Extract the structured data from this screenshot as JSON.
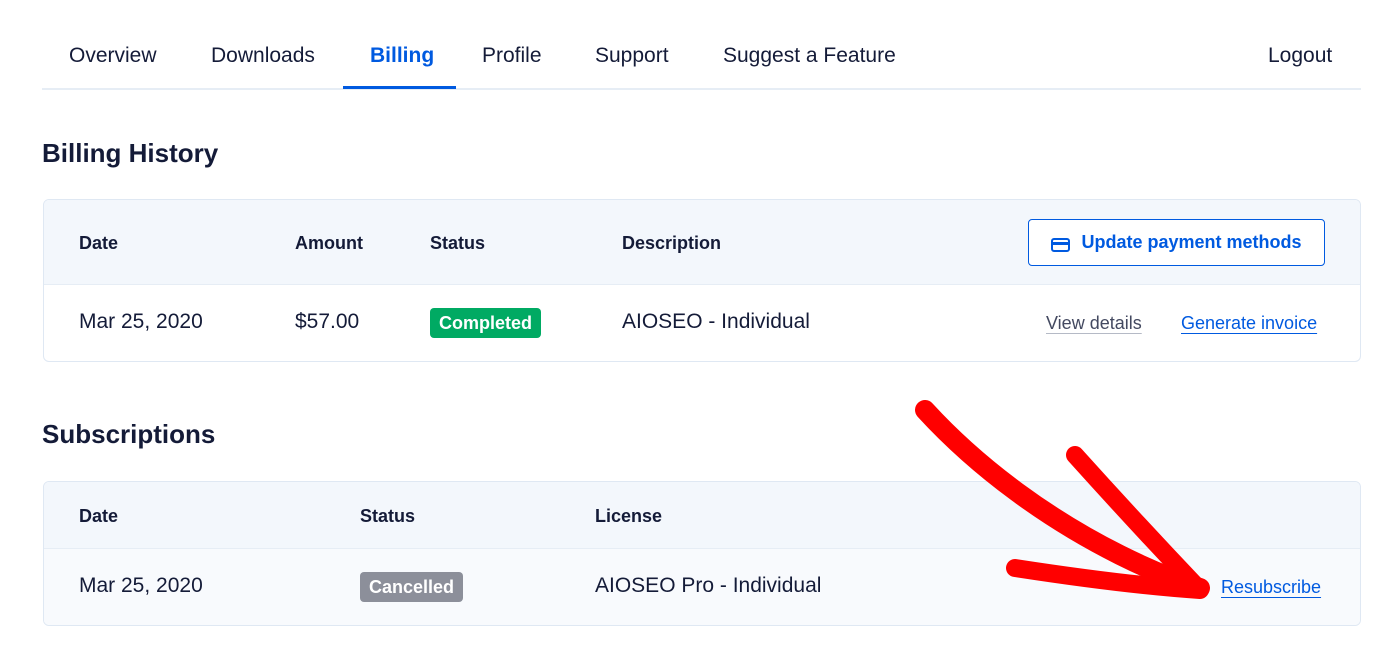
{
  "nav": {
    "items": [
      {
        "label": "Overview",
        "active": false
      },
      {
        "label": "Downloads",
        "active": false
      },
      {
        "label": "Billing",
        "active": true
      },
      {
        "label": "Profile",
        "active": false
      },
      {
        "label": "Support",
        "active": false
      },
      {
        "label": "Suggest a Feature",
        "active": false
      }
    ],
    "logout": "Logout"
  },
  "billing": {
    "title": "Billing History",
    "columns": [
      "Date",
      "Amount",
      "Status",
      "Description"
    ],
    "update_button": "Update payment methods",
    "update_button_icon": "credit-card-icon",
    "rows": [
      {
        "date": "Mar 25, 2020",
        "amount": "$57.00",
        "status": "Completed",
        "description": "AIOSEO - Individual",
        "view_details": "View details",
        "generate_invoice": "Generate invoice"
      }
    ]
  },
  "subscriptions": {
    "title": "Subscriptions",
    "columns": [
      "Date",
      "Status",
      "License"
    ],
    "rows": [
      {
        "date": "Mar 25, 2020",
        "status": "Cancelled",
        "license": "AIOSEO Pro - Individual",
        "action": "Resubscribe"
      }
    ]
  },
  "colors": {
    "accent": "#005ae0",
    "text": "#141b38",
    "completed": "#00aa63",
    "cancelled": "#8c8f9a",
    "annotation_arrow": "#ff0000"
  }
}
